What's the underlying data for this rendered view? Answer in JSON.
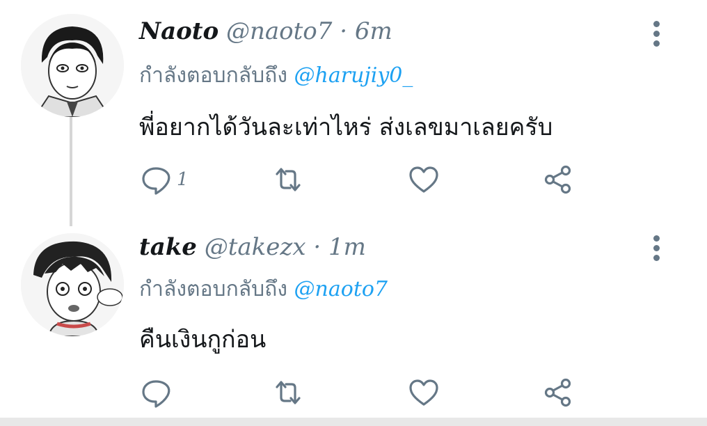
{
  "tweets": [
    {
      "name": "Naoto",
      "handle": "@naoto7",
      "separator": "·",
      "time": "6m",
      "reply_prefix": "กำลังตอบกลับถึง",
      "reply_to": "@harujiy0_",
      "text": "พี่อยากได้วันละเท่าไหร่ ส่งเลขมาเลยครับ",
      "reply_count": "1",
      "icons": [
        "more-vertical-icon",
        "reply-icon",
        "retweet-icon",
        "like-icon",
        "share-icon"
      ]
    },
    {
      "name": "take",
      "handle": "@takezx",
      "separator": "·",
      "time": "1m",
      "reply_prefix": "กำลังตอบกลับถึง",
      "reply_to": "@naoto7",
      "text": "คืนเงินกูก่อน",
      "reply_count": "",
      "icons": [
        "more-vertical-icon",
        "reply-icon",
        "retweet-icon",
        "like-icon",
        "share-icon"
      ]
    }
  ],
  "colors": {
    "text_primary": "#14171a",
    "text_secondary": "#657786",
    "link": "#1da1f2",
    "thread_line": "#d6d6d6"
  }
}
